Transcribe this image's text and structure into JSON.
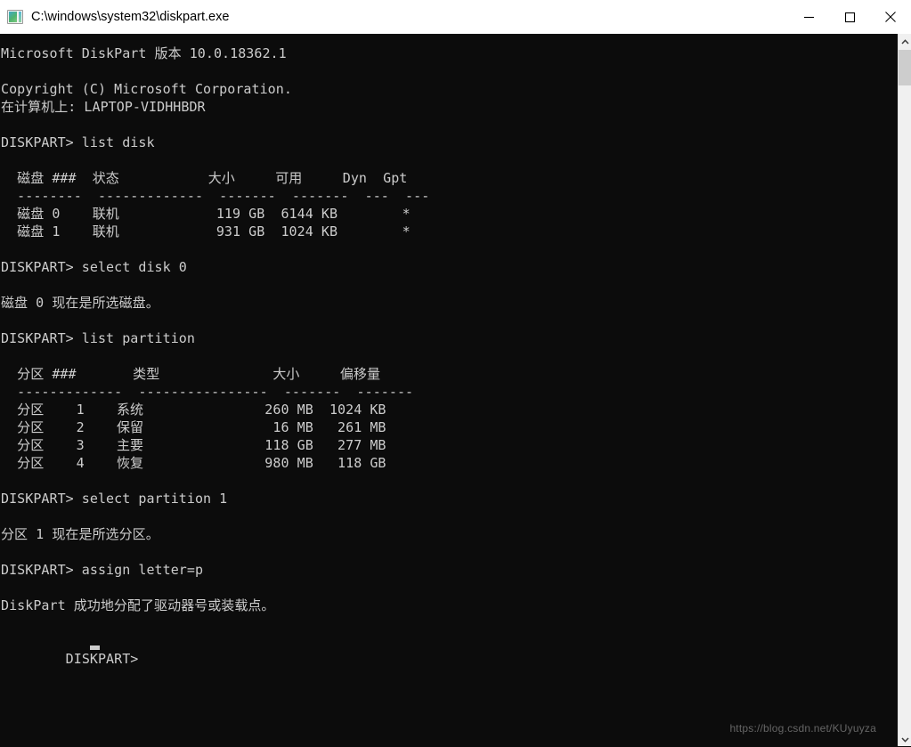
{
  "window": {
    "title": "C:\\windows\\system32\\diskpart.exe",
    "icon": "console-app-icon",
    "controls": {
      "minimize": "minimize-icon",
      "maximize": "maximize-icon",
      "close": "close-icon"
    }
  },
  "colors": {
    "console_bg": "#0c0c0c",
    "console_fg": "#cccccc",
    "titlebar_bg": "#ffffff",
    "titlebar_fg": "#000000",
    "scrollbar_track": "#f0f0f0",
    "scrollbar_thumb": "#cdcdcd"
  },
  "console": {
    "prompt": "DISKPART>",
    "lines": [
      "Microsoft DiskPart 版本 10.0.18362.1",
      "",
      "Copyright (C) Microsoft Corporation.",
      "在计算机上: LAPTOP-VIDHHBDR",
      "",
      "DISKPART> list disk",
      "",
      "  磁盘 ###  状态           大小     可用     Dyn  Gpt",
      "  --------  -------------  -------  -------  ---  ---",
      "  磁盘 0    联机            119 GB  6144 KB        *",
      "  磁盘 1    联机            931 GB  1024 KB        *",
      "",
      "DISKPART> select disk 0",
      "",
      "磁盘 0 现在是所选磁盘。",
      "",
      "DISKPART> list partition",
      "",
      "  分区 ###       类型              大小     偏移量",
      "  -------------  ----------------  -------  -------",
      "  分区    1    系统               260 MB  1024 KB",
      "  分区    2    保留                16 MB   261 MB",
      "  分区    3    主要               118 GB   277 MB",
      "  分区    4    恢复               980 MB   118 GB",
      "",
      "DISKPART> select partition 1",
      "",
      "分区 1 现在是所选分区。",
      "",
      "DISKPART> assign letter=p",
      "",
      "DiskPart 成功地分配了驱动器号或装载点。",
      "",
      "DISKPART> "
    ],
    "disk_table": {
      "headers": [
        "磁盘 ###",
        "状态",
        "大小",
        "可用",
        "Dyn",
        "Gpt"
      ],
      "rows": [
        [
          "磁盘 0",
          "联机",
          "119 GB",
          "6144 KB",
          "",
          "*"
        ],
        [
          "磁盘 1",
          "联机",
          "931 GB",
          "1024 KB",
          "",
          "*"
        ]
      ]
    },
    "partition_table": {
      "headers": [
        "分区 ###",
        "类型",
        "大小",
        "偏移量"
      ],
      "rows": [
        [
          "分区    1",
          "系统",
          "260 MB",
          "1024 KB"
        ],
        [
          "分区    2",
          "保留",
          "16 MB",
          "261 MB"
        ],
        [
          "分区    3",
          "主要",
          "118 GB",
          "277 MB"
        ],
        [
          "分区    4",
          "恢复",
          "980 MB",
          "118 GB"
        ]
      ]
    },
    "commands": [
      "list disk",
      "select disk 0",
      "list partition",
      "select partition 1",
      "assign letter=p"
    ],
    "messages": [
      "磁盘 0 现在是所选磁盘。",
      "分区 1 现在是所选分区。",
      "DiskPart 成功地分配了驱动器号或装载点。"
    ],
    "version_line": "Microsoft DiskPart 版本 10.0.18362.1",
    "copyright_line": "Copyright (C) Microsoft Corporation.",
    "machine_line": "在计算机上: LAPTOP-VIDHHBDR",
    "computer_name": "LAPTOP-VIDHHBDR",
    "version": "10.0.18362.1"
  },
  "watermark": {
    "text": "https://blog.csdn.net/KUyuyza"
  },
  "scrollbar": {
    "up_arrow": "chevron-up-icon",
    "down_arrow": "chevron-down-icon"
  }
}
